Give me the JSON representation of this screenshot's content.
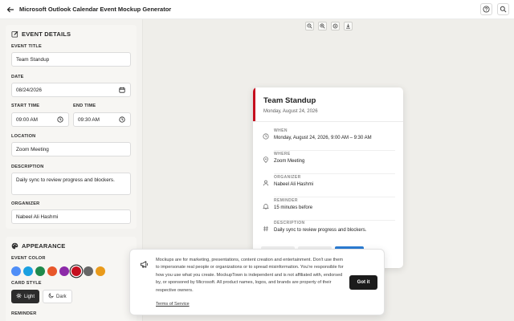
{
  "app": {
    "title": "Microsoft Outlook Calendar Event Mockup Generator"
  },
  "event_details": {
    "section_title": "EVENT DETAILS",
    "title_label": "EVENT TITLE",
    "title_value": "Team Standup",
    "date_label": "DATE",
    "date_value": "08/24/2026",
    "start_label": "START TIME",
    "start_value": "09:00 AM",
    "end_label": "END TIME",
    "end_value": "09:30 AM",
    "location_label": "LOCATION",
    "location_value": "Zoom Meeting",
    "description_label": "DESCRIPTION",
    "description_value": "Daily sync to review progress and blockers.",
    "organizer_label": "ORGANIZER",
    "organizer_value": "Nabeel Ali Hashmi"
  },
  "appearance": {
    "section_title": "APPEARANCE",
    "color_label": "EVENT COLOR",
    "colors": [
      "#4f8ef7",
      "#1aa0e0",
      "#1f8a4c",
      "#e8572a",
      "#8c2aa8",
      "#c50f1f",
      "#666666",
      "#e99a1a"
    ],
    "selected_color": "#c50f1f",
    "style_label": "CARD STYLE",
    "light_label": "Light",
    "dark_label": "Dark",
    "reminder_label": "REMINDER"
  },
  "preview": {
    "title": "Team Standup",
    "date": "Monday, August 24, 2026",
    "when_label": "WHEN",
    "when_value": "Monday, August 24, 2026, 9:00 AM – 9:30 AM",
    "where_label": "WHERE",
    "where_value": "Zoom Meeting",
    "organizer_label": "ORGANIZER",
    "organizer_value": "Nabeel Ali Hashmi",
    "reminder_label": "REMINDER",
    "reminder_value": "15 minutes before",
    "description_label": "DESCRIPTION",
    "description_value": "Daily sync to review progress and blockers.",
    "accent_color": "#c50f1f"
  },
  "notice": {
    "message": "Mockups are for marketing, presentations, content creation and entertainment. Don't use them to impersonate real people or organizations or to spread misinformation. You're responsible for how you use what you create. MockupTown is independent and is not affiliated with, endorsed by, or sponsored by Microsoft. All product names, logos, and brands are property of their respective owners.",
    "terms_link": "Terms of Service",
    "button": "Got it"
  }
}
